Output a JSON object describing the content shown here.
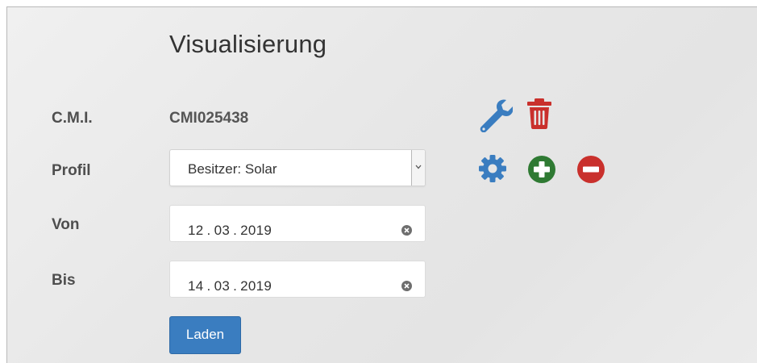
{
  "page": {
    "title": "Visualisierung"
  },
  "form": {
    "cmi": {
      "label": "C.M.I.",
      "value": "CMI025438"
    },
    "profil": {
      "label": "Profil",
      "selected": "Besitzer: Solar"
    },
    "von": {
      "label": "Von",
      "value": "12 . 03 . 2019"
    },
    "bis": {
      "label": "Bis",
      "value": "14 . 03 . 2019"
    },
    "submit_label": "Laden"
  },
  "icons": {
    "wrench": "wrench-icon",
    "trash": "trash-icon",
    "gear": "gear-icon",
    "add": "plus-circle-icon",
    "remove": "minus-circle-icon",
    "clear": "clear-icon"
  },
  "colors": {
    "primary_blue": "#3a7dc0",
    "danger_red": "#c9302c",
    "success_green": "#2f7a33",
    "label_text": "#4e4e4e"
  }
}
